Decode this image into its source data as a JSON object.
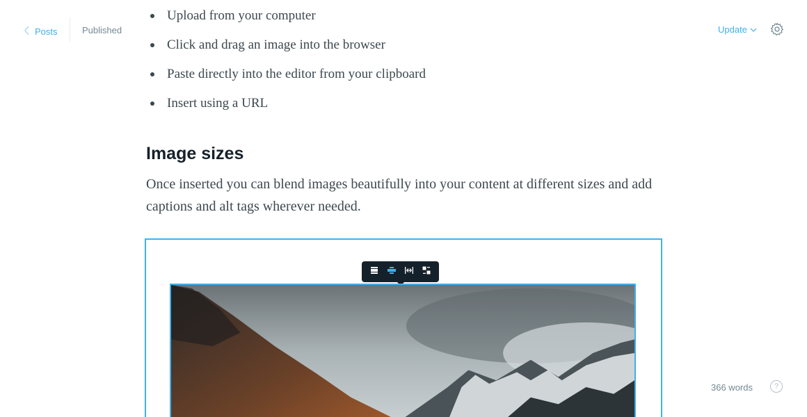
{
  "header": {
    "back_label": "Posts",
    "status": "Published",
    "update_label": "Update"
  },
  "editor": {
    "bullets": [
      "Upload from your computer",
      "Click and drag an image into the browser",
      "Paste directly into the editor from your clipboard",
      "Insert using a URL"
    ],
    "heading": "Image sizes",
    "paragraph": "Once inserted you can blend images beautifully into your content at different sizes and add captions and alt tags wherever needed."
  },
  "image_toolbar": {
    "buttons": [
      "width-regular-icon",
      "width-wide-icon",
      "width-full-icon",
      "replace-image-icon"
    ],
    "active_index": 1
  },
  "footer": {
    "word_count": "366 words",
    "help_label": "?"
  },
  "colors": {
    "accent": "#3eb0ef",
    "text_dark": "#15212a",
    "text_muted": "#738a94"
  }
}
